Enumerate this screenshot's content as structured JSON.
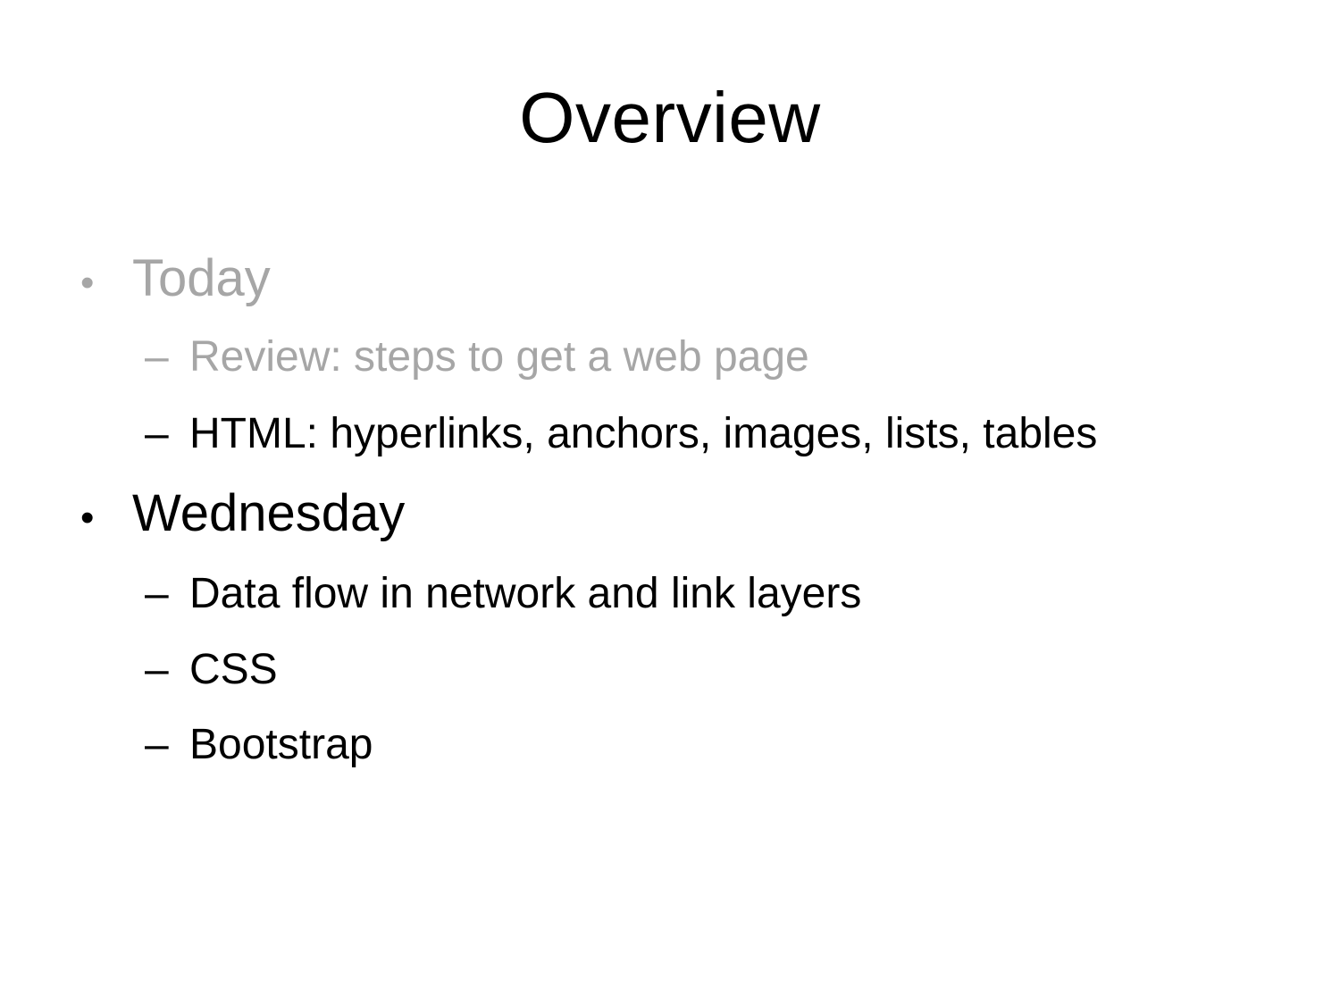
{
  "slide": {
    "title": "Overview",
    "bullet_glyph": "•",
    "dash_glyph": "–",
    "sections": [
      {
        "label": "Today",
        "dimmed": true,
        "items": [
          {
            "text": "Review: steps to get a web page",
            "dimmed": true
          },
          {
            "text": "HTML: hyperlinks, anchors, images, lists, tables",
            "dimmed": false
          }
        ]
      },
      {
        "label": "Wednesday",
        "dimmed": false,
        "items": [
          {
            "text": "Data flow in network and link layers",
            "dimmed": false
          },
          {
            "text": "CSS",
            "dimmed": false
          },
          {
            "text": "Bootstrap",
            "dimmed": false
          }
        ]
      }
    ],
    "colors": {
      "dimmed_text": "#a6a6a6",
      "normal_text": "#000000",
      "background": "#ffffff"
    }
  }
}
